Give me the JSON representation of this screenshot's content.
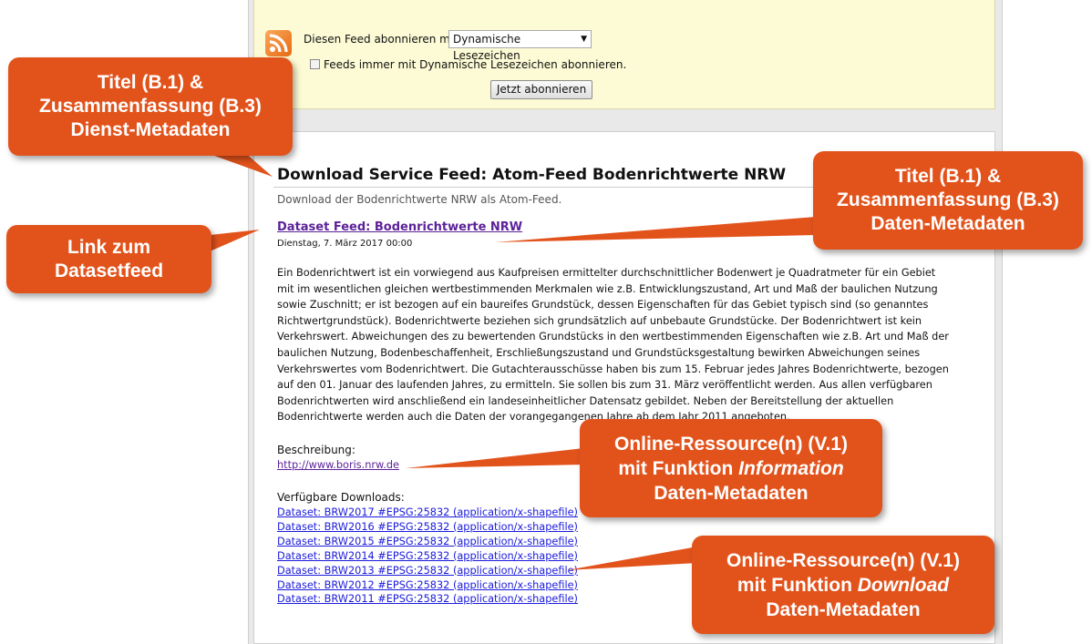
{
  "subscribe": {
    "label": "Diesen Feed abonnieren mit",
    "select_value": "Dynamische Lesezeichen",
    "checkbox_label": "Feeds immer mit Dynamische Lesezeichen abonnieren.",
    "button": "Jetzt abonnieren"
  },
  "feed": {
    "title": "Download Service Feed: Atom-Feed Bodenrichtwerte NRW",
    "subtitle": "Download der Bodenrichtwerte NRW als Atom-Feed.",
    "entry_title": "Dataset Feed: Bodenrichtwerte NRW",
    "entry_date": "Dienstag, 7. März 2017 00:00",
    "description": "Ein Bodenrichtwert ist ein vorwiegend aus Kaufpreisen ermittelter durchschnittlicher Bodenwert je Quadratmeter für ein Gebiet mit im wesentlichen gleichen wertbestimmenden Merkmalen wie z.B. Entwicklungszustand, Art und Maß der baulichen Nutzung sowie Zuschnitt; er ist bezogen auf ein baureifes Grundstück, dessen Eigenschaften für das Gebiet typisch sind (so genanntes Richtwertgrundstück). Bodenrichtwerte beziehen sich grundsätzlich auf unbebaute Grundstücke. Der Bodenrichtwert ist kein Verkehrswert. Abweichungen des zu bewertenden Grundstücks in den wertbestimmenden Eigenschaften wie z.B. Art und Maß der baulichen Nutzung, Bodenbeschaffenheit, Erschließungszustand und Grundstücksgestaltung bewirken Abweichungen seines Verkehrswertes vom Bodenrichtwert. Die Gutachterausschüsse haben bis zum 15. Februar jedes Jahres Bodenrichtwerte, bezogen auf den 01. Januar des laufenden Jahres, zu ermitteln. Sie sollen bis zum 31. März veröffentlicht werden. Aus allen verfügbaren Bodenrichtwerten wird anschließend ein landeseinheitlicher Datensatz gebildet. Neben der Bereitstellung der aktuellen Bodenrichtwerte werden auch die Daten der vorangegangenen Jahre ab dem Jahr 2011 angeboten.",
    "desc_label": "Beschreibung:",
    "desc_link": "http://www.boris.nrw.de",
    "downloads_label": "Verfügbare Downloads:",
    "downloads": [
      "Dataset: BRW2017 #EPSG:25832 (application/x-shapefile)",
      "Dataset: BRW2016 #EPSG:25832 (application/x-shapefile)",
      "Dataset: BRW2015 #EPSG:25832 (application/x-shapefile)",
      "Dataset: BRW2014 #EPSG:25832 (application/x-shapefile)",
      "Dataset: BRW2013 #EPSG:25832 (application/x-shapefile)",
      "Dataset: BRW2012 #EPSG:25832 (application/x-shapefile)",
      "Dataset: BRW2011 #EPSG:25832 (application/x-shapefile)"
    ]
  },
  "callouts": {
    "service_meta": [
      "Titel (B.1) &",
      "Zusammenfassung (B.3)",
      "Dienst-Metadaten"
    ],
    "link_dataset": [
      "Link zum",
      "Datasetfeed"
    ],
    "data_meta": [
      "Titel (B.1) &",
      "Zusammenfassung (B.3)",
      "Daten-Metadaten"
    ],
    "info_resource": {
      "line1": "Online-Ressource(n) (V.1)",
      "line2_prefix": "mit Funktion ",
      "line2_em": "Information",
      "line3": "Daten-Metadaten"
    },
    "download_resource": {
      "line1": "Online-Ressource(n) (V.1)",
      "line2_prefix": "mit Funktion ",
      "line2_em": "Download",
      "line3": "Daten-Metadaten"
    }
  },
  "colors": {
    "callout": "#e2531c",
    "visited_link": "#5c2299",
    "link": "#1a1adc"
  },
  "icons": [
    "rss-feed-icon",
    "dropdown-arrow-icon"
  ]
}
